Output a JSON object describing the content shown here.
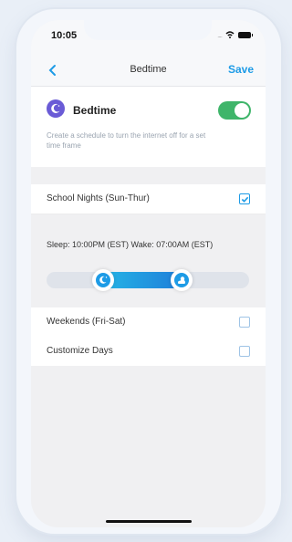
{
  "status": {
    "time": "10:05"
  },
  "nav": {
    "title": "Bedtime",
    "save_label": "Save"
  },
  "bedtime": {
    "title": "Bedtime",
    "description": "Create a schedule to turn the internet off for a set time frame",
    "enabled": true
  },
  "options": {
    "school": {
      "label": "School Nights (Sun-Thur)",
      "checked": true
    },
    "weekend": {
      "label": "Weekends (Fri-Sat)",
      "checked": false
    },
    "custom": {
      "label": "Customize Days",
      "checked": false
    }
  },
  "schedule": {
    "sleep_wake": "Sleep: 10:00PM (EST) Wake: 07:00AM (EST)"
  },
  "colors": {
    "accent": "#1d9be6",
    "toggle_on": "#3fb56a",
    "moon_badge": "#6a5bd6"
  }
}
